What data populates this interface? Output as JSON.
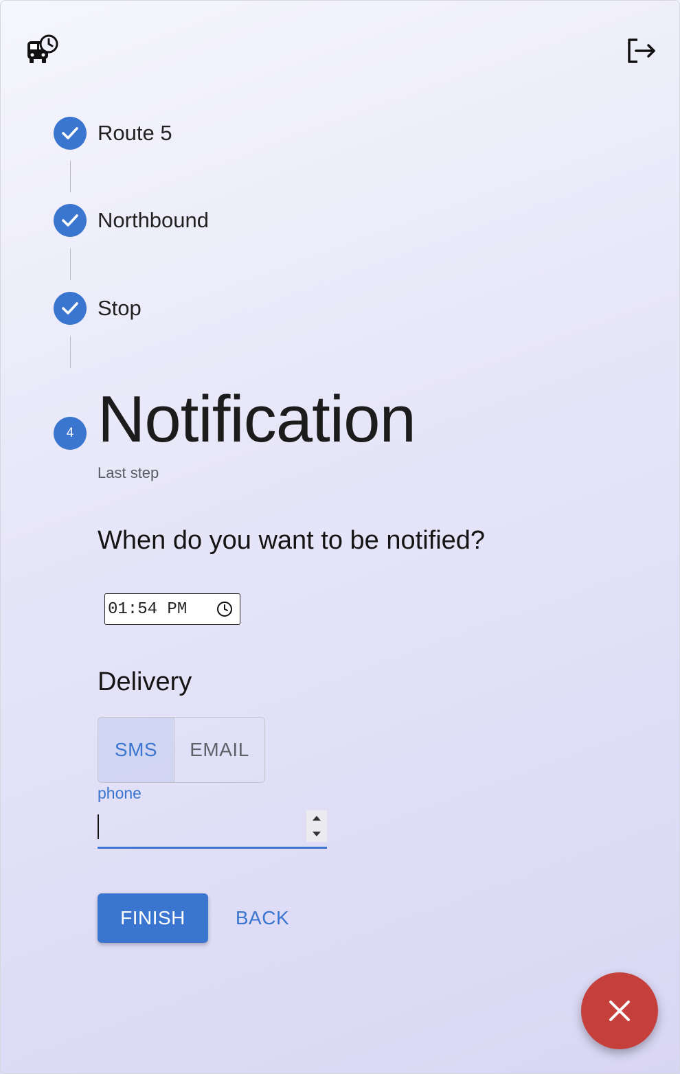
{
  "header": {
    "app_icon": "bus-clock-icon",
    "logout_icon": "logout-icon"
  },
  "stepper": {
    "steps": [
      {
        "label": "Route 5",
        "status": "completed"
      },
      {
        "label": "Northbound",
        "status": "completed"
      },
      {
        "label": "Stop",
        "status": "completed"
      }
    ],
    "active": {
      "number": "4",
      "title": "Notification",
      "subtitle": "Last step"
    }
  },
  "form": {
    "question": "When do you want to be notified?",
    "time_value": "01:54 PM",
    "delivery_title": "Delivery",
    "delivery_options": [
      "SMS",
      "EMAIL"
    ],
    "delivery_selected": "SMS",
    "phone_label": "phone",
    "phone_value": ""
  },
  "actions": {
    "finish_label": "FINISH",
    "back_label": "BACK",
    "close_icon": "close-icon"
  },
  "colors": {
    "primary": "#3a75cf",
    "fab": "#c5403a"
  }
}
